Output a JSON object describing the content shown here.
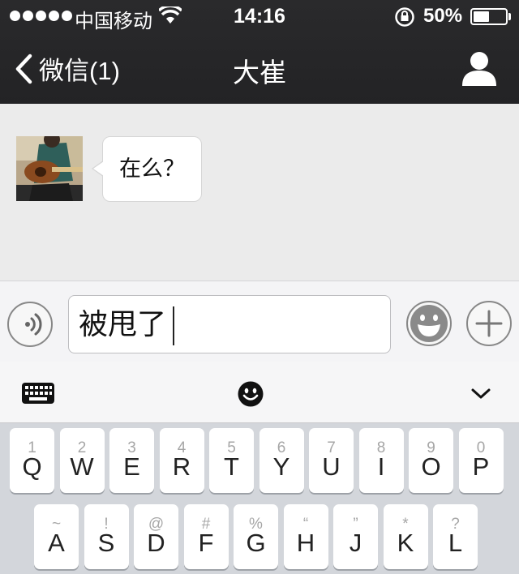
{
  "status_bar": {
    "carrier": "中国移动",
    "time": "14:16",
    "battery_percent": "50%",
    "battery_level": 0.5,
    "icons": [
      "signal-dots-icon",
      "wifi-icon",
      "rotation-lock-icon",
      "battery-icon"
    ]
  },
  "nav": {
    "back_label": "微信(1)",
    "title": "大崔",
    "icons": [
      "chevron-left-icon",
      "profile-icon"
    ]
  },
  "chat": {
    "messages": [
      {
        "sender": "contact",
        "text": "在么？"
      }
    ]
  },
  "input": {
    "value": "被甩了",
    "icons": [
      "voice-icon",
      "emoji-icon",
      "plus-icon"
    ]
  },
  "keyboard": {
    "toolbar_icons": [
      "keyboard-icon",
      "smiley-icon",
      "chevron-down-icon"
    ],
    "row1": [
      {
        "letter": "Q",
        "hint": "1"
      },
      {
        "letter": "W",
        "hint": "2"
      },
      {
        "letter": "E",
        "hint": "3"
      },
      {
        "letter": "R",
        "hint": "4"
      },
      {
        "letter": "T",
        "hint": "5"
      },
      {
        "letter": "Y",
        "hint": "6"
      },
      {
        "letter": "U",
        "hint": "7"
      },
      {
        "letter": "I",
        "hint": "8"
      },
      {
        "letter": "O",
        "hint": "9"
      },
      {
        "letter": "P",
        "hint": "0"
      }
    ],
    "row2": [
      {
        "letter": "A",
        "hint": "~"
      },
      {
        "letter": "S",
        "hint": "!"
      },
      {
        "letter": "D",
        "hint": "@"
      },
      {
        "letter": "F",
        "hint": "#"
      },
      {
        "letter": "G",
        "hint": "%"
      },
      {
        "letter": "H",
        "hint": "“"
      },
      {
        "letter": "J",
        "hint": "”"
      },
      {
        "letter": "K",
        "hint": "*"
      },
      {
        "letter": "L",
        "hint": "?"
      }
    ]
  },
  "colors": {
    "nav_background": "#262628",
    "chat_background": "#ebebeb",
    "keyboard_background": "#d3d6db"
  }
}
